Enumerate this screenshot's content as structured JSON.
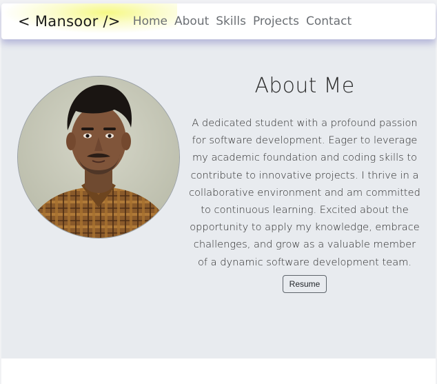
{
  "navbar": {
    "brand": "< Mansoor />",
    "links": [
      "Home",
      "About",
      "Skills",
      "Projects",
      "Contact"
    ]
  },
  "about": {
    "title": "About Me",
    "bio": "A dedicated student with a profound passion for software development. Eager to leverage my academic foundation and coding skills to contribute to innovative projects. I thrive in a collaborative environment and am committed to continuous learning. Excited about the opportunity to apply my knowledge, embrace challenges, and grow as a valuable member of a dynamic software development team.",
    "resume_label": "Resume",
    "photo_label": "profile-photo"
  },
  "colors": {
    "section_bg": "#e8ebef",
    "nav_shadow": "#7878be",
    "brand_glow": "#f5f878"
  }
}
